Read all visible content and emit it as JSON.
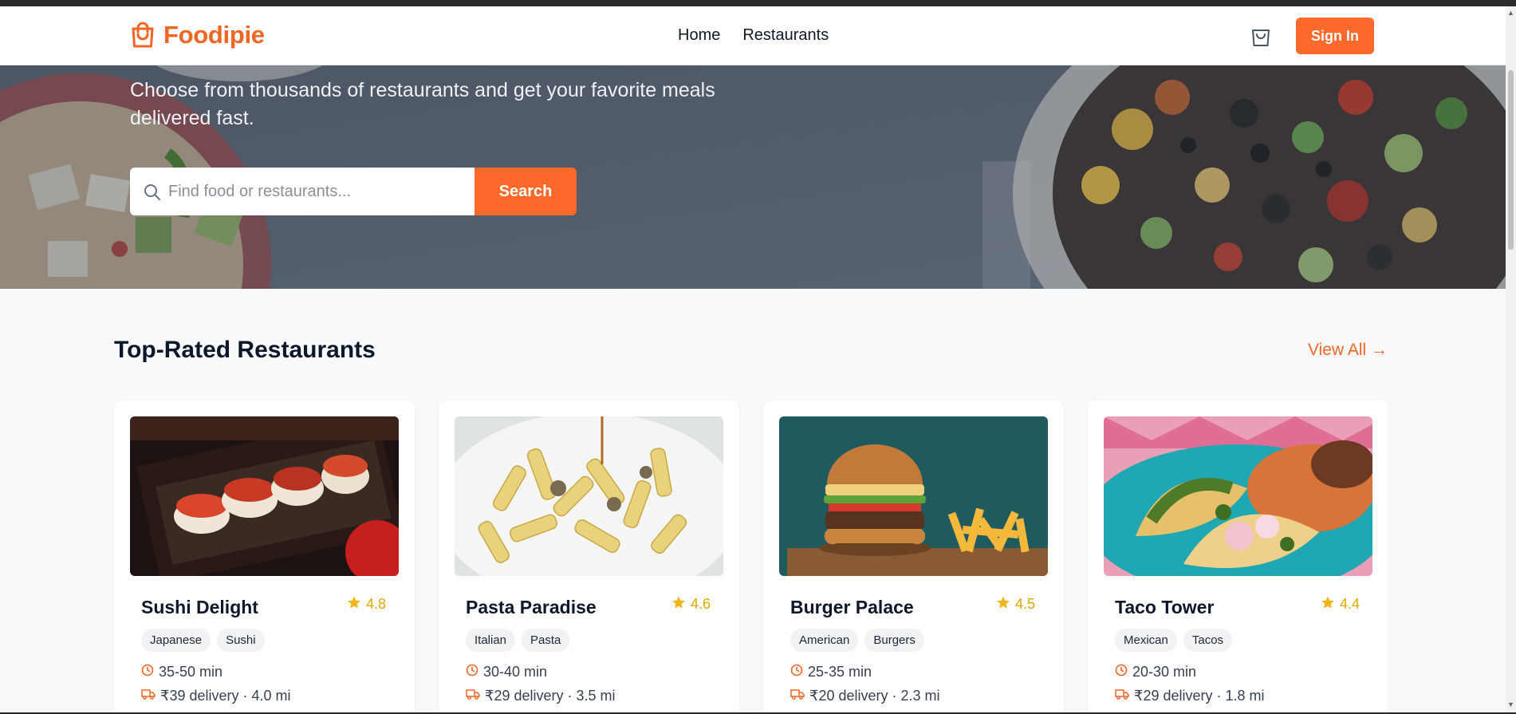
{
  "brand": {
    "name": "Foodipie",
    "accent": "#f26524",
    "button_color": "#ff6a2b"
  },
  "nav": {
    "links": [
      "Home",
      "Restaurants"
    ],
    "cart_icon": "shopping-bag-icon",
    "sign_in": "Sign In"
  },
  "hero": {
    "subtitle": "Choose from thousands of restaurants and get your favorite meals delivered fast.",
    "search_placeholder": "Find food or restaurants...",
    "search_button": "Search"
  },
  "section": {
    "title": "Top-Rated Restaurants",
    "view_all": "View All →"
  },
  "restaurants": [
    {
      "name": "Sushi Delight",
      "rating": "4.8",
      "tags": [
        "Japanese",
        "Sushi"
      ],
      "time": "35-50 min",
      "delivery": "₹39 delivery · 4.0 mi"
    },
    {
      "name": "Pasta Paradise",
      "rating": "4.6",
      "tags": [
        "Italian",
        "Pasta"
      ],
      "time": "30-40 min",
      "delivery": "₹29 delivery · 3.5 mi"
    },
    {
      "name": "Burger Palace",
      "rating": "4.5",
      "tags": [
        "American",
        "Burgers"
      ],
      "time": "25-35 min",
      "delivery": "₹20 delivery · 2.3 mi"
    },
    {
      "name": "Taco Tower",
      "rating": "4.4",
      "tags": [
        "Mexican",
        "Tacos"
      ],
      "time": "20-30 min",
      "delivery": "₹29 delivery · 1.8 mi"
    }
  ]
}
